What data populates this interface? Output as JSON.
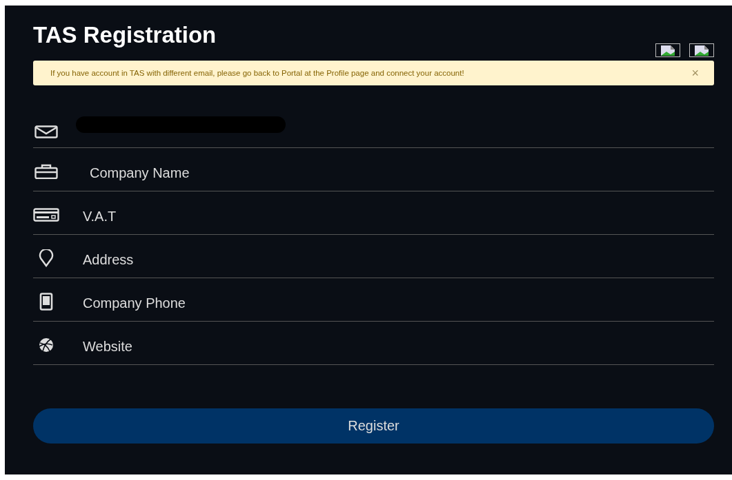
{
  "title": "TAS Registration",
  "header_images": [
    {
      "kind": "broken-image"
    },
    {
      "kind": "broken-image"
    }
  ],
  "alert": {
    "message": "If you have account in TAS with different email, please go back to Portal at the Profile page and connect your account!",
    "close": "×"
  },
  "fields": [
    {
      "kind": "email",
      "redacted": true
    },
    {
      "kind": "company",
      "placeholder": "Company Name"
    },
    {
      "kind": "vat",
      "placeholder": "V.A.T"
    },
    {
      "kind": "address",
      "placeholder": "Address"
    },
    {
      "kind": "phone",
      "placeholder": "Company Phone"
    },
    {
      "kind": "website",
      "placeholder": "Website"
    }
  ],
  "submit": "Register"
}
